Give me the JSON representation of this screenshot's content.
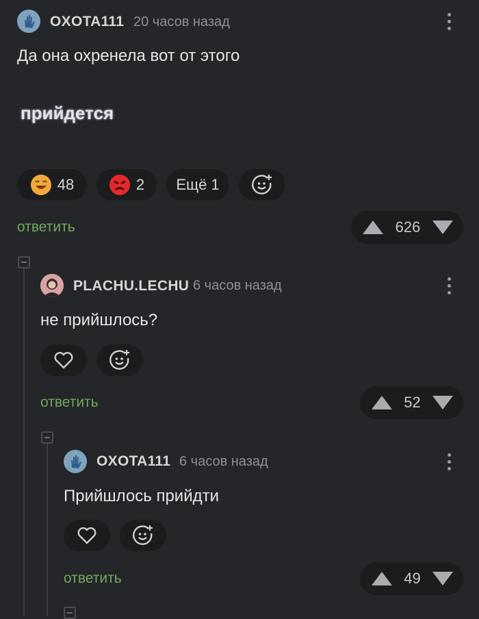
{
  "comments": [
    {
      "username": "OXOTA111",
      "time": "20 часов назад",
      "text": "Да она охренела вот от этого",
      "image_text": "прийдется",
      "reactions": [
        {
          "icon": "laughing-emoji-icon",
          "count": "48"
        },
        {
          "icon": "angry-emoji-icon",
          "count": "2"
        }
      ],
      "more_reactions": "Ещё 1",
      "reply_label": "ответить",
      "rating": "626"
    },
    {
      "username": "PLACHU.LECHU",
      "time": "6 часов назад",
      "text": "не прийшлось?",
      "reply_label": "ответить",
      "rating": "52"
    },
    {
      "username": "OXOTA111",
      "time": "6 часов назад",
      "text": "Прийшлось прийдти",
      "reply_label": "ответить",
      "rating": "49"
    }
  ],
  "colors": {
    "background": "#242629",
    "pill": "#1a1c1e",
    "reply": "#6bab5a",
    "angry": "#e02a2a",
    "laughing": "#f2a93b"
  }
}
